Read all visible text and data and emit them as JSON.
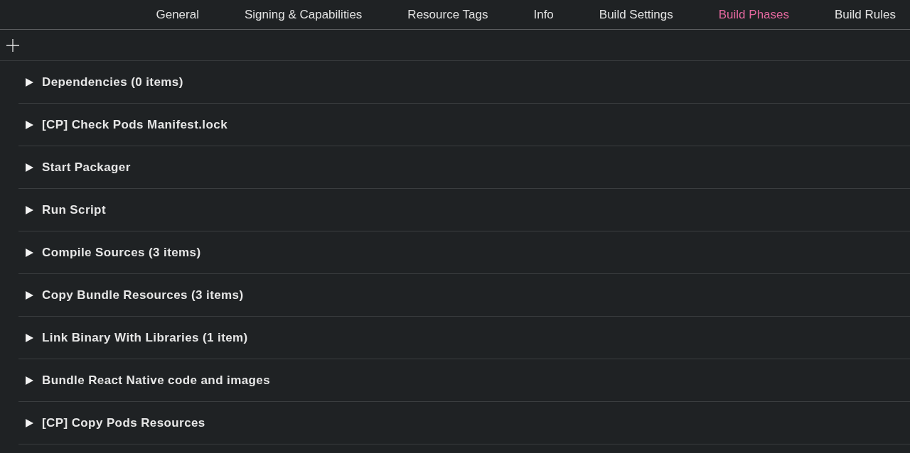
{
  "tabs": [
    {
      "label": "General",
      "selected": false
    },
    {
      "label": "Signing & Capabilities",
      "selected": false
    },
    {
      "label": "Resource Tags",
      "selected": false
    },
    {
      "label": "Info",
      "selected": false
    },
    {
      "label": "Build Settings",
      "selected": false
    },
    {
      "label": "Build Phases",
      "selected": true
    },
    {
      "label": "Build Rules",
      "selected": false
    }
  ],
  "phases": [
    {
      "title": "Dependencies (0 items)",
      "expanded": false
    },
    {
      "title": "[CP] Check Pods Manifest.lock",
      "expanded": false
    },
    {
      "title": "Start Packager",
      "expanded": false
    },
    {
      "title": "Run Script",
      "expanded": false
    },
    {
      "title": "Compile Sources (3 items)",
      "expanded": false
    },
    {
      "title": "Copy Bundle Resources (3 items)",
      "expanded": false
    },
    {
      "title": "Link Binary With Libraries (1 item)",
      "expanded": false
    },
    {
      "title": "Bundle React Native code and images",
      "expanded": false
    },
    {
      "title": "[CP] Copy Pods Resources",
      "expanded": false
    }
  ]
}
